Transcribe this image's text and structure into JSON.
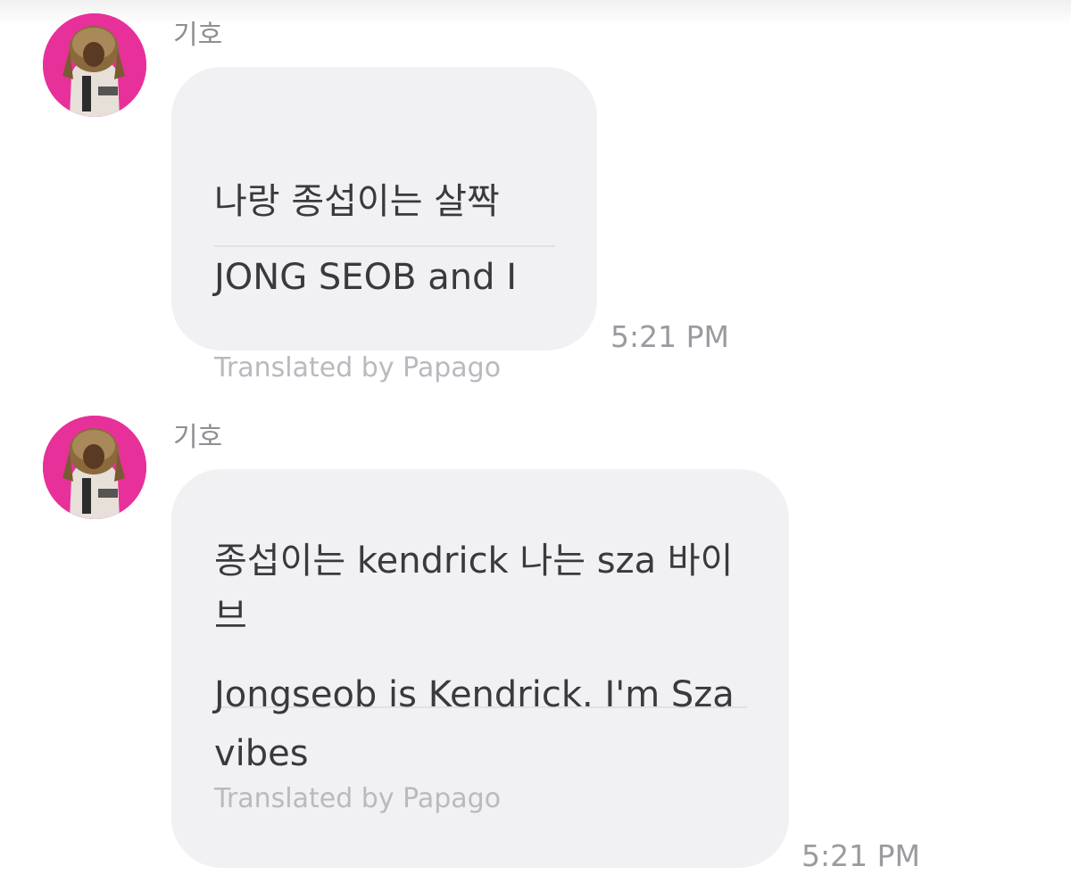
{
  "messages": [
    {
      "sender": "기호",
      "original_text": "나랑 종섭이는 살짝",
      "translated_text": "JONG SEOB and I",
      "translation_credit": "Translated by Papago",
      "timestamp": "5:21 PM",
      "avatar_icon": "profile-photo"
    },
    {
      "sender": "기호",
      "original_text": "종섭이는 kendrick 나는 sza 바이브",
      "translated_text": "Jongseob is Kendrick. I'm Sza vibes",
      "translation_credit": "Translated by Papago",
      "timestamp": "5:21 PM",
      "avatar_icon": "profile-photo"
    }
  ],
  "colors": {
    "bubble_background": "#f1f1f4",
    "avatar_background": "#e8309a",
    "text_primary": "#3a3a3c",
    "text_secondary": "#8e8e93",
    "credit_text": "#b9b9bf"
  }
}
